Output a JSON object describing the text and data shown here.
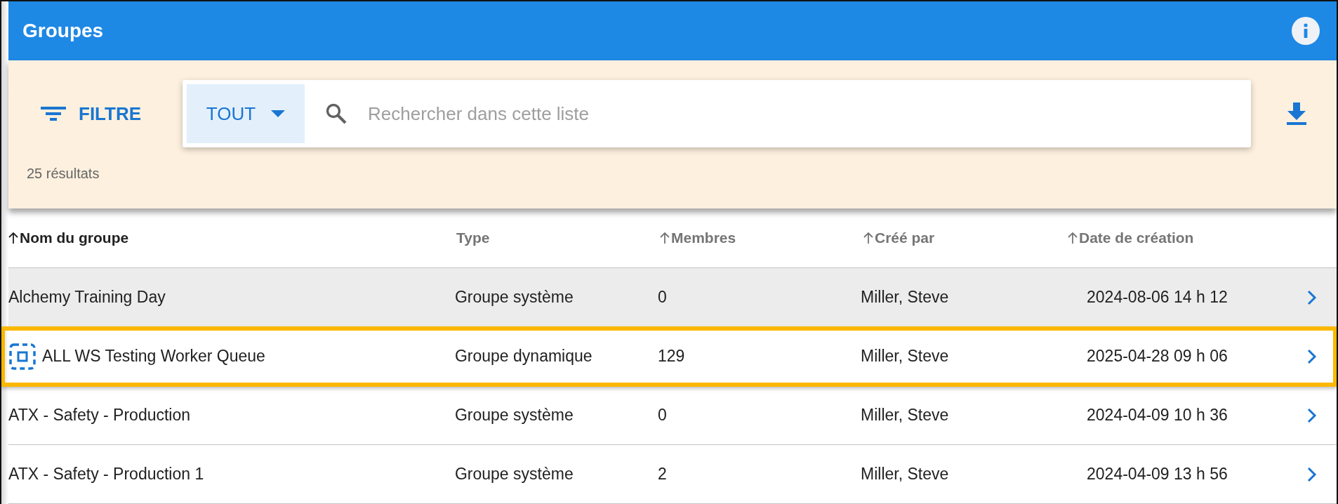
{
  "header": {
    "title": "Groupes"
  },
  "toolbar": {
    "filter_label": "FILTRE",
    "scope": "TOUT",
    "search": {
      "placeholder": "Rechercher dans cette liste"
    },
    "result_count": "25 résultats"
  },
  "table": {
    "columns": [
      {
        "label": "Nom du groupe",
        "sortable": true,
        "active": true
      },
      {
        "label": "Type",
        "sortable": false,
        "active": false
      },
      {
        "label": "Membres",
        "sortable": true,
        "active": false
      },
      {
        "label": "Créé par",
        "sortable": true,
        "active": false
      },
      {
        "label": "Date de création",
        "sortable": true,
        "active": false
      }
    ],
    "rows": [
      {
        "kind": "system",
        "name": "Alchemy Training Day",
        "type": "Groupe système",
        "members": "0",
        "created_by": "Miller, Steve",
        "created_at": "2024-08-06 14 h 12",
        "hovered": true,
        "outlined": false
      },
      {
        "kind": "dynamic",
        "name": "ALL WS Testing Worker Queue",
        "type": "Groupe dynamique",
        "members": "129",
        "created_by": "Miller, Steve",
        "created_at": "2025-04-28 09 h 06",
        "hovered": false,
        "outlined": true
      },
      {
        "kind": "system",
        "name": "ATX - Safety - Production",
        "type": "Groupe système",
        "members": "0",
        "created_by": "Miller, Steve",
        "created_at": "2024-04-09 10 h 36",
        "hovered": false,
        "outlined": false
      },
      {
        "kind": "system",
        "name": "ATX - Safety - Production 1",
        "type": "Groupe système",
        "members": "2",
        "created_by": "Miller, Steve",
        "created_at": "2024-04-09 13 h 56",
        "hovered": false,
        "outlined": false
      }
    ]
  }
}
